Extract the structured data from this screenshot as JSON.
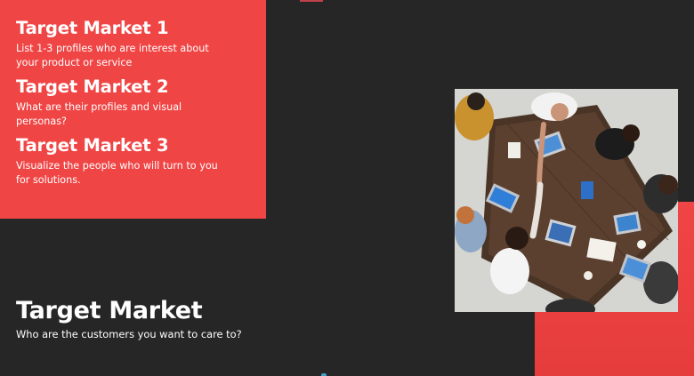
{
  "markets": [
    {
      "title": "Target Market 1",
      "description": "List 1-3 profiles who are interest about your product or service"
    },
    {
      "title": "Target Market 2",
      "description": "What are their profiles and visual personas?"
    },
    {
      "title": "Target Market 3",
      "description": "Visualize the people who will turn to you for solutions."
    }
  ],
  "main": {
    "title": "Target Market",
    "subtitle": "Who are the customers you want to care to?"
  },
  "photo": {
    "icon": "team-meeting-photo"
  },
  "colors": {
    "background": "#262626",
    "accent_red": "#f04545",
    "text": "#ffffff"
  }
}
